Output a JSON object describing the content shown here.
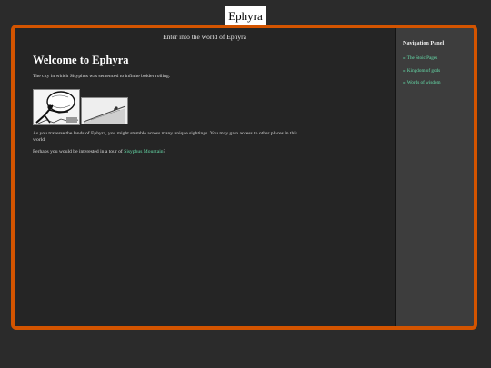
{
  "site": {
    "title": "Ephyra",
    "accent": "#d35400",
    "link_color": "#66ddaa"
  },
  "main": {
    "tagline": "Enter into the world of Ephyra",
    "heading": "Welcome to Ephyra",
    "intro": "The city in which Sisyphus was sentenced to infinite bolder rolling.",
    "paragraph": "As you traverse the lands of Ephyra, you might stumble across many unique sightings. You may gain access to other places in this world.",
    "tour_prefix": "Perhaps you would be interested in a tour of ",
    "tour_link": "Sisyphus Mountain",
    "tour_suffix": "?",
    "images": [
      {
        "icon": "sisyphus-boulder-illustration"
      },
      {
        "icon": "mountain-slope-illustration"
      }
    ]
  },
  "sidebar": {
    "title": "Navigation Panel",
    "items": [
      {
        "label": "The Stoic Pages",
        "bullet": "»"
      },
      {
        "label": "Kingdom of gods",
        "bullet": "»"
      },
      {
        "label": "Words of wisdom",
        "bullet": "»"
      }
    ]
  }
}
